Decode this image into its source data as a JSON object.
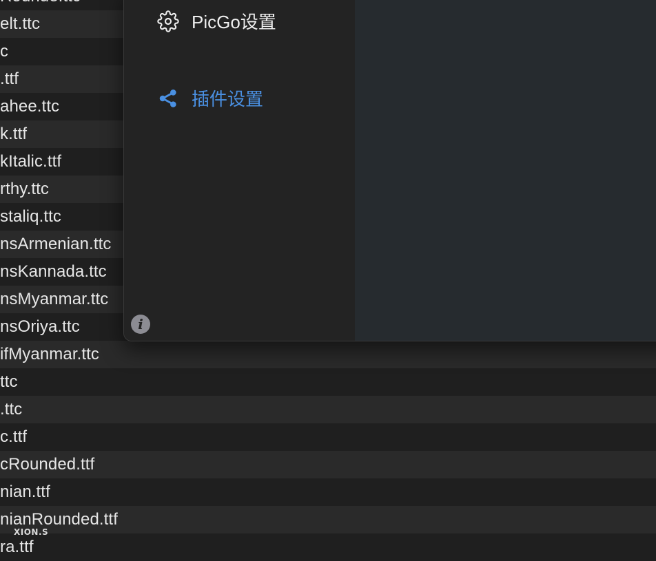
{
  "file_list": {
    "rows": [
      "Rounde.ttc",
      "elt.ttc",
      "c",
      ".ttf",
      "ahee.ttc",
      "k.ttf",
      "kItalic.ttf",
      "rthy.ttc",
      "staliq.ttc",
      "nsArmenian.ttc",
      "nsKannada.ttc",
      "nsMyanmar.ttc",
      "nsOriya.ttc",
      "ifMyanmar.ttc",
      "ttc",
      ".ttc",
      "c.ttf",
      "cRounded.ttf",
      "nian.ttf",
      "nianRounded.ttf",
      "ra.ttf"
    ]
  },
  "settings_window": {
    "menu": {
      "picgo_settings": {
        "label": "PicGo设置",
        "icon": "gear-icon"
      },
      "plugin_settings": {
        "label": "插件设置",
        "icon": "share-icon",
        "active": true
      }
    },
    "info_button": {
      "glyph": "i",
      "icon": "info-icon"
    },
    "colors": {
      "accent": "#4a90e2",
      "sidebar_bg": "#232323",
      "content_bg": "#262b2f"
    }
  },
  "watermark": {
    "text": "XION.S"
  }
}
